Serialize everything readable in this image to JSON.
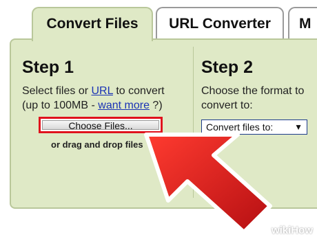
{
  "tabs": [
    {
      "label": "Convert Files"
    },
    {
      "label": "URL Converter"
    },
    {
      "label": "M"
    }
  ],
  "step1": {
    "title": "Step 1",
    "line1_prefix": "Select files or ",
    "url_link": "URL",
    "line1_suffix": " to convert",
    "line2_prefix": "(up to 100MB - ",
    "want_more_link": "want more",
    "line2_suffix": " ?)",
    "choose_button": "Choose Files...",
    "drag_text": "or drag and drop files"
  },
  "step2": {
    "title": "Step 2",
    "line1": "Choose the format to",
    "line2": "convert to:",
    "select_value": "Convert files to:",
    "select_arrow": "▼"
  },
  "watermark": "wikiHow",
  "colors": {
    "panel": "#dfe9c6",
    "highlight": "#e0121d",
    "link": "#1a33b5"
  }
}
